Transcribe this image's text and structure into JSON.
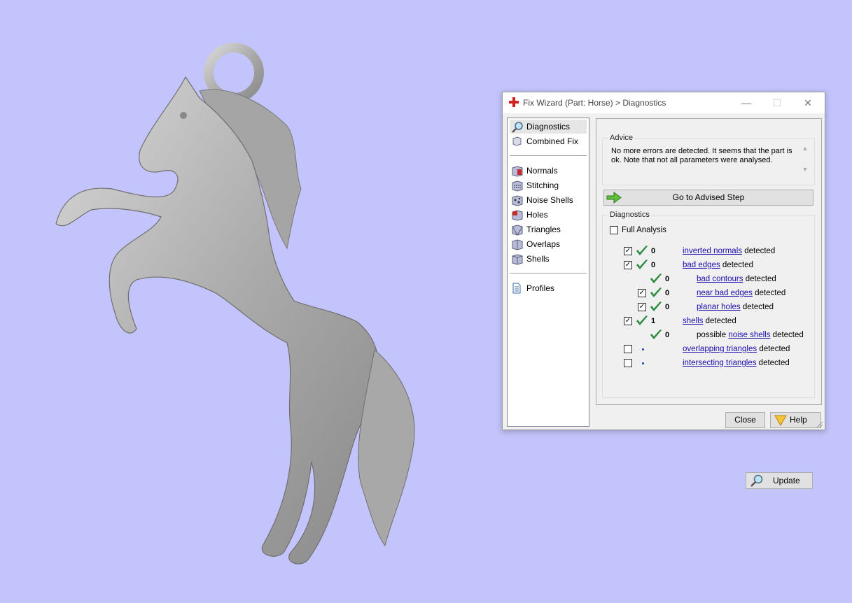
{
  "window": {
    "title": "Fix Wizard (Part: Horse) > Diagnostics",
    "minimize": "—",
    "maximize": "☐",
    "close": "✕"
  },
  "nav": {
    "top": [
      {
        "label": "Diagnostics",
        "icon": "magnifier-icon",
        "selected": true
      },
      {
        "label": "Combined Fix",
        "icon": "cube-icon"
      }
    ],
    "steps": [
      {
        "label": "Normals",
        "icon": "normals-cube-icon"
      },
      {
        "label": "Stitching",
        "icon": "stitching-cube-icon"
      },
      {
        "label": "Noise Shells",
        "icon": "noise-shells-cube-icon"
      },
      {
        "label": "Holes",
        "icon": "holes-cube-icon"
      },
      {
        "label": "Triangles",
        "icon": "triangles-cube-icon"
      },
      {
        "label": "Overlaps",
        "icon": "overlaps-cube-icon"
      },
      {
        "label": "Shells",
        "icon": "shells-cube-icon"
      }
    ],
    "bottom": [
      {
        "label": "Profiles",
        "icon": "document-icon"
      }
    ]
  },
  "advice": {
    "title": "Advice",
    "text": "No more errors are detected. It seems that the part is ok. Note that not all parameters were analysed.",
    "button": "Go to Advised Step"
  },
  "diagnostics": {
    "title": "Diagnostics",
    "full_analysis": {
      "label": "Full Analysis",
      "checked": false
    },
    "rows": [
      {
        "checked": true,
        "status": "ok",
        "count": "0",
        "prefix": "",
        "link": "inverted normals",
        "suffix": " detected"
      },
      {
        "checked": true,
        "status": "ok",
        "count": "0",
        "prefix": "",
        "link": "bad edges",
        "suffix": " detected"
      },
      {
        "checked": null,
        "status": "ok",
        "count": "0",
        "prefix": "",
        "link": "bad contours",
        "suffix": " detected"
      },
      {
        "checked": true,
        "status": "ok",
        "count": "0",
        "prefix": "",
        "link": "near bad edges",
        "suffix": " detected"
      },
      {
        "checked": true,
        "status": "ok",
        "count": "0",
        "prefix": "",
        "link": "planar holes",
        "suffix": " detected"
      },
      {
        "checked": true,
        "status": "ok",
        "count": "1",
        "prefix": "",
        "link": "shells",
        "suffix": " detected"
      },
      {
        "checked": null,
        "status": "ok",
        "count": "0",
        "prefix": "possible ",
        "link": "noise shells",
        "suffix": " detected"
      },
      {
        "checked": false,
        "status": "unknown",
        "count": "",
        "prefix": "",
        "link": "overlapping triangles",
        "suffix": " detected"
      },
      {
        "checked": false,
        "status": "unknown",
        "count": "",
        "prefix": "",
        "link": "intersecting triangles",
        "suffix": " detected"
      }
    ],
    "update_button": "Update"
  },
  "footer": {
    "close": "Close",
    "help": "Help"
  },
  "colors": {
    "background": "#c4c4fc",
    "check_green": "#2e8b3e",
    "link": "#1a0dab",
    "model_grey": "#b0b0b0"
  }
}
